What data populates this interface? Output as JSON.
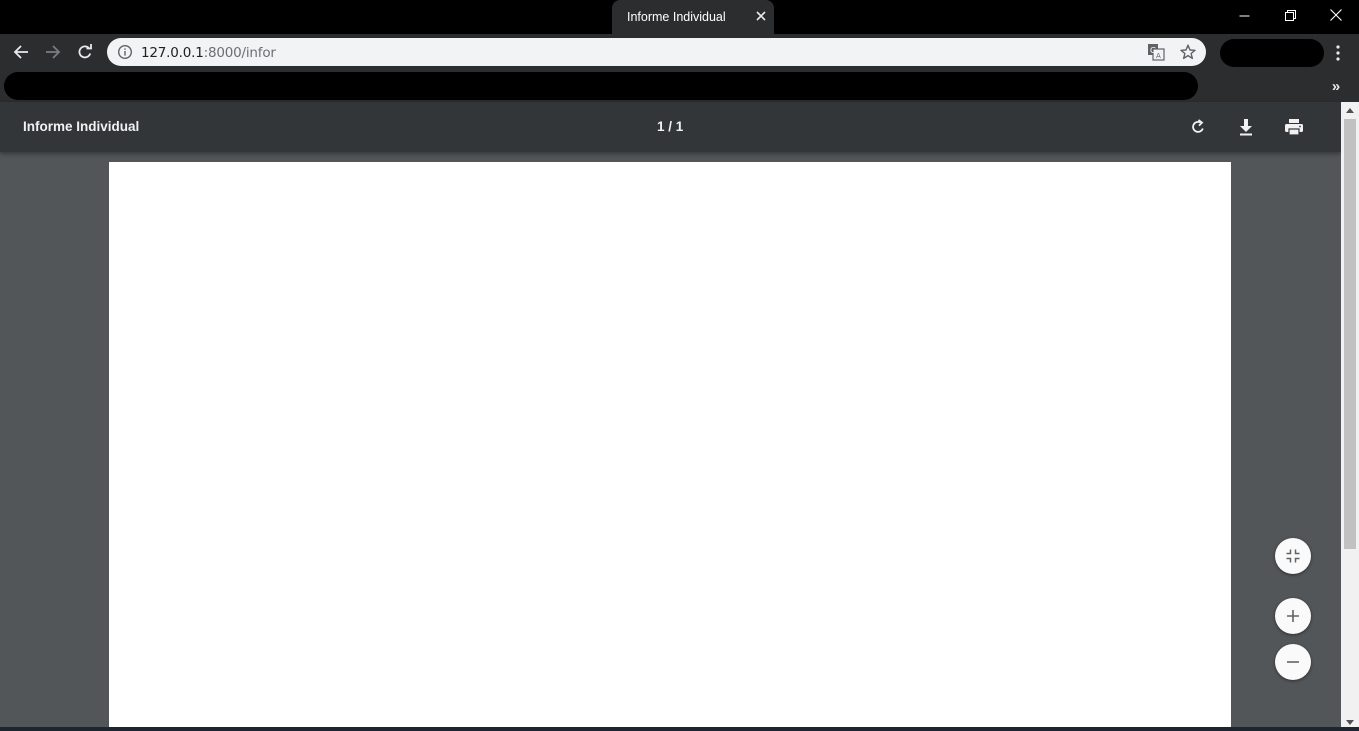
{
  "browser": {
    "tab_title": "Informe Individual",
    "url_host": "127.0.0.1",
    "url_path": ":8000/infor"
  },
  "pdf_viewer": {
    "title": "Informe Individual",
    "page_indicator": "1 / 1"
  },
  "icons": {
    "tab_close": "close-icon",
    "minimize": "minimize-icon",
    "restore": "restore-icon",
    "close_window": "close-icon",
    "back": "arrow-left-icon",
    "forward": "arrow-right-icon",
    "reload": "reload-icon",
    "site_info": "info-icon",
    "translate": "translate-icon",
    "bookmark": "star-icon",
    "menu": "kebab-menu-icon",
    "bookmarks_overflow": "chevron-double-right-icon",
    "rotate": "rotate-icon",
    "download": "download-icon",
    "print": "print-icon",
    "fit": "fit-to-page-icon",
    "zoom_in": "plus-icon",
    "zoom_out": "minus-icon"
  },
  "bookmarks_overflow_glyph": "»",
  "colors": {
    "chrome_dark": "#2b2d2f",
    "pdf_toolbar": "#323639",
    "viewer_bg": "#525659",
    "page": "#ffffff"
  }
}
